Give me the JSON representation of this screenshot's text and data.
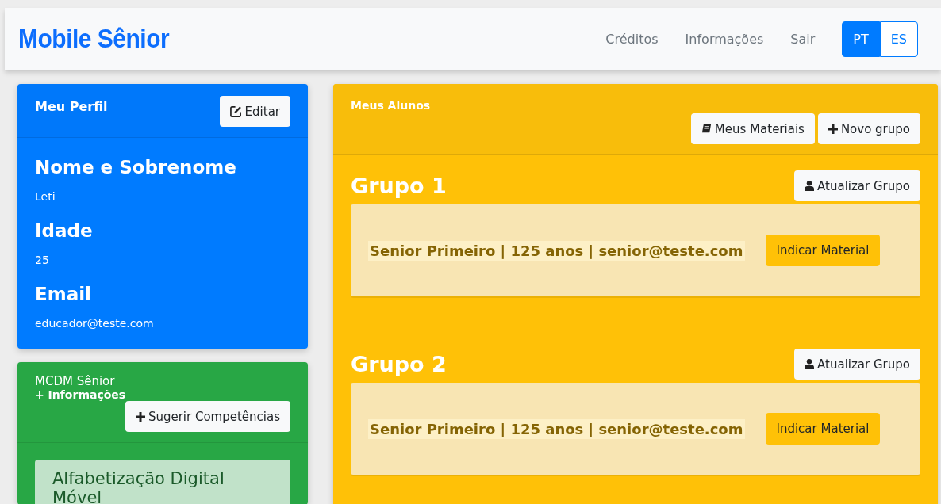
{
  "navbar": {
    "brand": "Mobile Sênior",
    "links": [
      "Créditos",
      "Informações",
      "Sair"
    ],
    "languages": [
      {
        "label": "PT",
        "selected": true
      },
      {
        "label": "ES",
        "selected": false
      }
    ]
  },
  "profile": {
    "title": "Meu Perfil",
    "edit_button": "Editar",
    "fields": [
      {
        "label": "Nome e Sobrenome",
        "value": "Leti"
      },
      {
        "label": "Idade",
        "value": "25"
      },
      {
        "label": "Email",
        "value": "educador@teste.com"
      }
    ]
  },
  "mcdm": {
    "title": "MCDM Sênior",
    "more_link": "+ Informações",
    "suggest_button": "Sugerir Competências",
    "items": [
      "Alfabetização Digital Móvel"
    ]
  },
  "students": {
    "title": "Meus Alunos",
    "materials_button": "Meus Materiais",
    "new_group_button": "Novo grupo",
    "groups": [
      {
        "name": "Grupo 1",
        "update_button": "Atualizar Grupo",
        "students": [
          {
            "info": "Senior Primeiro | 125 anos | senior@teste.com",
            "action": "Indicar Material"
          }
        ]
      },
      {
        "name": "Grupo 2",
        "update_button": "Atualizar Grupo",
        "students": [
          {
            "info": "Senior Primeiro | 125 anos | senior@teste.com",
            "action": "Indicar Material"
          }
        ]
      }
    ]
  }
}
